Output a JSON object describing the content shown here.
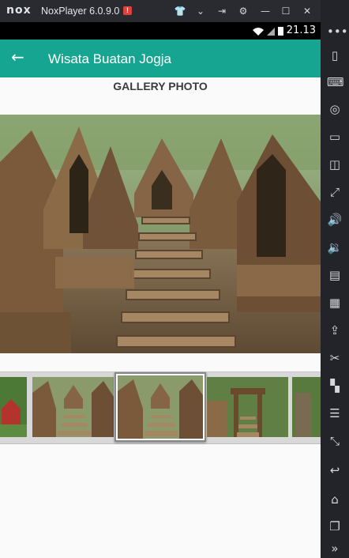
{
  "emulator": {
    "logo": "nox",
    "version": "NoxPlayer 6.0.9.0",
    "warning_badge": "!",
    "title_icons": [
      "shirt-icon",
      "chevron-down-icon",
      "pin-icon",
      "gear-icon",
      "minimize-icon",
      "maximize-icon",
      "close-icon"
    ],
    "toolbar_icons": [
      "more-icon",
      "phone-icon",
      "keyboard-icon",
      "location-icon",
      "screen-icon",
      "screenshot-icon",
      "fullscreen-icon",
      "volume-up-icon",
      "volume-down-icon",
      "apk-icon",
      "macro-icon",
      "install-apk-icon",
      "scissors-icon",
      "multi-instance-icon",
      "menu-icon",
      "resize-icon",
      "back-icon",
      "home-icon",
      "recents-icon",
      "expand-icon"
    ]
  },
  "statusbar": {
    "time": "21.13"
  },
  "appbar": {
    "title": "Wisata Buatan Jogja"
  },
  "gallery": {
    "title": "GALLERY PHOTO",
    "thumbnails": 5,
    "selected_index": 2
  },
  "colors": {
    "accent": "#16a590",
    "statusbar": "#000000",
    "emulator_bg": "#23242a"
  }
}
